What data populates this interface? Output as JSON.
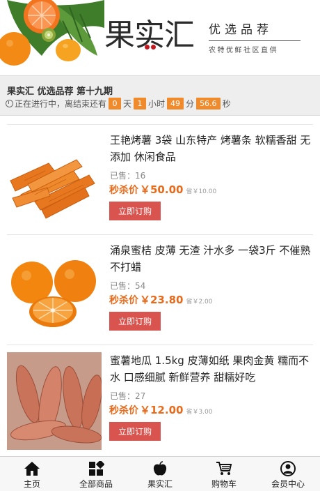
{
  "header": {
    "brand_name": "果实汇",
    "brand_tag": "优选品荐",
    "brand_sub": "农特优鲜社区直供"
  },
  "info": {
    "title": "果实汇 优选品荐 第十九期",
    "status_prefix": "正在进行中，离结束还有",
    "days": "0",
    "days_unit": "天",
    "hours": "1",
    "hours_unit": "小时",
    "minutes": "49",
    "minutes_unit": "分",
    "seconds": "56.6",
    "seconds_unit": "秒"
  },
  "products": [
    {
      "name": "王艳烤薯 3袋 山东特产 烤薯条 软糯香甜 无添加 休闲食品",
      "sold": "已售：16",
      "price_label": "秒杀价",
      "price": "￥50.00",
      "save": "省￥10.00",
      "buy_label": "立即订购"
    },
    {
      "name": "涌泉蜜桔 皮薄 无渣 汁水多 一袋3斤 不催熟 不打蜡",
      "sold": "已售：54",
      "price_label": "秒杀价",
      "price": "￥23.80",
      "save": "省￥2.00",
      "buy_label": "立即订购"
    },
    {
      "name": "蜜薯地瓜 1.5kg 皮薄如纸 果肉金黄 糯而不水 口感细腻 新鲜营养 甜糯好吃",
      "sold": "已售：27",
      "price_label": "秒杀价",
      "price": "￥12.00",
      "save": "省￥3.00",
      "buy_label": "立即订购"
    }
  ],
  "nav": [
    {
      "label": "主页",
      "icon": "home-icon"
    },
    {
      "label": "全部商品",
      "icon": "grid-icon"
    },
    {
      "label": "果实汇",
      "icon": "apple-icon"
    },
    {
      "label": "购物车",
      "icon": "cart-icon"
    },
    {
      "label": "会员中心",
      "icon": "user-icon"
    }
  ],
  "colors": {
    "accent_orange": "#e86a1b",
    "countdown_bg": "#f08b2d",
    "button_red": "#d9534f"
  }
}
